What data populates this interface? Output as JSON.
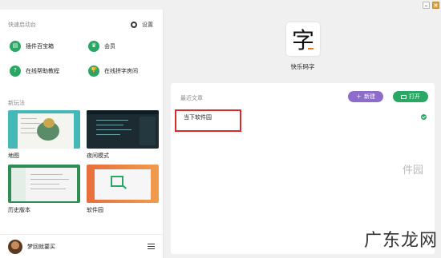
{
  "window": {
    "min_icon": "minimize-icon",
    "close_icon": "close-icon"
  },
  "left": {
    "title": "快速启动台",
    "settings_label": "设置",
    "quick_items": [
      {
        "label": "插件百宝箱",
        "icon": "plugin-icon",
        "glyph": "▤"
      },
      {
        "label": "会员",
        "icon": "crown-icon",
        "glyph": "♛"
      },
      {
        "label": "在线帮助教程",
        "icon": "help-icon",
        "glyph": "?"
      },
      {
        "label": "在线拼字房间",
        "icon": "trophy-icon",
        "glyph": "🏆"
      }
    ],
    "new_play_title": "新玩法",
    "cards": [
      {
        "label": "地图"
      },
      {
        "label": "夜间模式"
      },
      {
        "label": "历史版本"
      },
      {
        "label": "软件园"
      }
    ],
    "user_name": "梦回就要买"
  },
  "right": {
    "logo_char": "字",
    "app_name": "快乐码字",
    "recent_title": "最近文章",
    "new_button": "新建",
    "open_button": "打开",
    "rows": [
      {
        "name": "当下软件园",
        "synced": true
      }
    ],
    "watermark_main": "广东龙网",
    "watermark_side": "件园"
  },
  "colors": {
    "green": "#2aa764",
    "purple": "#8e6cc9",
    "highlight": "#d62b2b"
  }
}
